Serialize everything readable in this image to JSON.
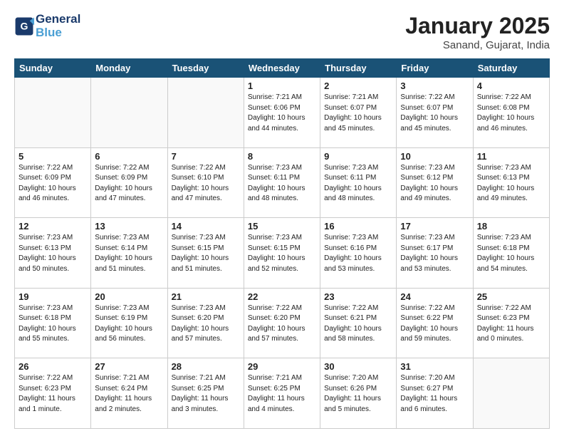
{
  "header": {
    "logo_line1": "General",
    "logo_line2": "Blue",
    "month_title": "January 2025",
    "subtitle": "Sanand, Gujarat, India"
  },
  "days_of_week": [
    "Sunday",
    "Monday",
    "Tuesday",
    "Wednesday",
    "Thursday",
    "Friday",
    "Saturday"
  ],
  "weeks": [
    [
      {
        "num": "",
        "info": ""
      },
      {
        "num": "",
        "info": ""
      },
      {
        "num": "",
        "info": ""
      },
      {
        "num": "1",
        "info": "Sunrise: 7:21 AM\nSunset: 6:06 PM\nDaylight: 10 hours\nand 44 minutes."
      },
      {
        "num": "2",
        "info": "Sunrise: 7:21 AM\nSunset: 6:07 PM\nDaylight: 10 hours\nand 45 minutes."
      },
      {
        "num": "3",
        "info": "Sunrise: 7:22 AM\nSunset: 6:07 PM\nDaylight: 10 hours\nand 45 minutes."
      },
      {
        "num": "4",
        "info": "Sunrise: 7:22 AM\nSunset: 6:08 PM\nDaylight: 10 hours\nand 46 minutes."
      }
    ],
    [
      {
        "num": "5",
        "info": "Sunrise: 7:22 AM\nSunset: 6:09 PM\nDaylight: 10 hours\nand 46 minutes."
      },
      {
        "num": "6",
        "info": "Sunrise: 7:22 AM\nSunset: 6:09 PM\nDaylight: 10 hours\nand 47 minutes."
      },
      {
        "num": "7",
        "info": "Sunrise: 7:22 AM\nSunset: 6:10 PM\nDaylight: 10 hours\nand 47 minutes."
      },
      {
        "num": "8",
        "info": "Sunrise: 7:23 AM\nSunset: 6:11 PM\nDaylight: 10 hours\nand 48 minutes."
      },
      {
        "num": "9",
        "info": "Sunrise: 7:23 AM\nSunset: 6:11 PM\nDaylight: 10 hours\nand 48 minutes."
      },
      {
        "num": "10",
        "info": "Sunrise: 7:23 AM\nSunset: 6:12 PM\nDaylight: 10 hours\nand 49 minutes."
      },
      {
        "num": "11",
        "info": "Sunrise: 7:23 AM\nSunset: 6:13 PM\nDaylight: 10 hours\nand 49 minutes."
      }
    ],
    [
      {
        "num": "12",
        "info": "Sunrise: 7:23 AM\nSunset: 6:13 PM\nDaylight: 10 hours\nand 50 minutes."
      },
      {
        "num": "13",
        "info": "Sunrise: 7:23 AM\nSunset: 6:14 PM\nDaylight: 10 hours\nand 51 minutes."
      },
      {
        "num": "14",
        "info": "Sunrise: 7:23 AM\nSunset: 6:15 PM\nDaylight: 10 hours\nand 51 minutes."
      },
      {
        "num": "15",
        "info": "Sunrise: 7:23 AM\nSunset: 6:15 PM\nDaylight: 10 hours\nand 52 minutes."
      },
      {
        "num": "16",
        "info": "Sunrise: 7:23 AM\nSunset: 6:16 PM\nDaylight: 10 hours\nand 53 minutes."
      },
      {
        "num": "17",
        "info": "Sunrise: 7:23 AM\nSunset: 6:17 PM\nDaylight: 10 hours\nand 53 minutes."
      },
      {
        "num": "18",
        "info": "Sunrise: 7:23 AM\nSunset: 6:18 PM\nDaylight: 10 hours\nand 54 minutes."
      }
    ],
    [
      {
        "num": "19",
        "info": "Sunrise: 7:23 AM\nSunset: 6:18 PM\nDaylight: 10 hours\nand 55 minutes."
      },
      {
        "num": "20",
        "info": "Sunrise: 7:23 AM\nSunset: 6:19 PM\nDaylight: 10 hours\nand 56 minutes."
      },
      {
        "num": "21",
        "info": "Sunrise: 7:23 AM\nSunset: 6:20 PM\nDaylight: 10 hours\nand 57 minutes."
      },
      {
        "num": "22",
        "info": "Sunrise: 7:22 AM\nSunset: 6:20 PM\nDaylight: 10 hours\nand 57 minutes."
      },
      {
        "num": "23",
        "info": "Sunrise: 7:22 AM\nSunset: 6:21 PM\nDaylight: 10 hours\nand 58 minutes."
      },
      {
        "num": "24",
        "info": "Sunrise: 7:22 AM\nSunset: 6:22 PM\nDaylight: 10 hours\nand 59 minutes."
      },
      {
        "num": "25",
        "info": "Sunrise: 7:22 AM\nSunset: 6:23 PM\nDaylight: 11 hours\nand 0 minutes."
      }
    ],
    [
      {
        "num": "26",
        "info": "Sunrise: 7:22 AM\nSunset: 6:23 PM\nDaylight: 11 hours\nand 1 minute."
      },
      {
        "num": "27",
        "info": "Sunrise: 7:21 AM\nSunset: 6:24 PM\nDaylight: 11 hours\nand 2 minutes."
      },
      {
        "num": "28",
        "info": "Sunrise: 7:21 AM\nSunset: 6:25 PM\nDaylight: 11 hours\nand 3 minutes."
      },
      {
        "num": "29",
        "info": "Sunrise: 7:21 AM\nSunset: 6:25 PM\nDaylight: 11 hours\nand 4 minutes."
      },
      {
        "num": "30",
        "info": "Sunrise: 7:20 AM\nSunset: 6:26 PM\nDaylight: 11 hours\nand 5 minutes."
      },
      {
        "num": "31",
        "info": "Sunrise: 7:20 AM\nSunset: 6:27 PM\nDaylight: 11 hours\nand 6 minutes."
      },
      {
        "num": "",
        "info": ""
      }
    ]
  ]
}
